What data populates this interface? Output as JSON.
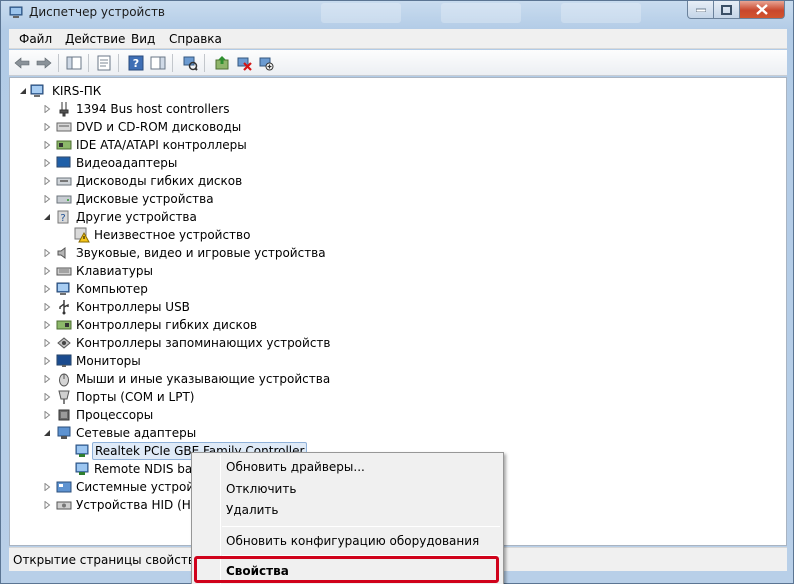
{
  "window": {
    "title": "Диспетчер устройств"
  },
  "menu": [
    "Файл",
    "Действие",
    "Вид",
    "Справка"
  ],
  "tree": {
    "root": "KIRS-ПК",
    "items": [
      {
        "label": "1394 Bus host controllers",
        "icon": "firewire-icon",
        "level": 1,
        "expanded": false
      },
      {
        "label": "DVD и CD-ROM дисководы",
        "icon": "dvd-drive-icon",
        "level": 1,
        "expanded": false
      },
      {
        "label": "IDE ATA/ATAPI контроллеры",
        "icon": "ide-controller-icon",
        "level": 1,
        "expanded": false
      },
      {
        "label": "Видеоадаптеры",
        "icon": "display-adapter-icon",
        "level": 1,
        "expanded": false
      },
      {
        "label": "Дисководы гибких дисков",
        "icon": "floppy-drive-icon",
        "level": 1,
        "expanded": false
      },
      {
        "label": "Дисковые устройства",
        "icon": "disk-drive-icon",
        "level": 1,
        "expanded": false
      },
      {
        "label": "Другие устройства",
        "icon": "other-devices-icon",
        "level": 1,
        "expanded": true
      },
      {
        "label": "Неизвестное устройство",
        "icon": "unknown-device-warning-icon",
        "level": 2,
        "expanded": null
      },
      {
        "label": "Звуковые, видео и игровые устройства",
        "icon": "speaker-icon",
        "level": 1,
        "expanded": false
      },
      {
        "label": "Клавиатуры",
        "icon": "keyboard-icon",
        "level": 1,
        "expanded": false
      },
      {
        "label": "Компьютер",
        "icon": "computer-icon",
        "level": 1,
        "expanded": false
      },
      {
        "label": "Контроллеры USB",
        "icon": "usb-icon",
        "level": 1,
        "expanded": false
      },
      {
        "label": "Контроллеры гибких дисков",
        "icon": "floppy-controller-icon",
        "level": 1,
        "expanded": false
      },
      {
        "label": "Контроллеры запоминающих устройств",
        "icon": "storage-controller-icon",
        "level": 1,
        "expanded": false
      },
      {
        "label": "Мониторы",
        "icon": "monitor-icon",
        "level": 1,
        "expanded": false
      },
      {
        "label": "Мыши и иные указывающие устройства",
        "icon": "mouse-icon",
        "level": 1,
        "expanded": false
      },
      {
        "label": "Порты (COM и LPT)",
        "icon": "port-icon",
        "level": 1,
        "expanded": false
      },
      {
        "label": "Процессоры",
        "icon": "processor-icon",
        "level": 1,
        "expanded": false
      },
      {
        "label": "Сетевые адаптеры",
        "icon": "network-adapter-icon",
        "level": 1,
        "expanded": true
      },
      {
        "label": "Realtek PCIe GBE Family Controller",
        "icon": "network-card-icon",
        "level": 2,
        "expanded": null,
        "selected": true
      },
      {
        "label": "Remote NDIS based",
        "icon": "network-card-icon",
        "level": 2,
        "expanded": null
      },
      {
        "label": "Системные устройс",
        "icon": "system-devices-icon",
        "level": 1,
        "expanded": false
      },
      {
        "label": "Устройства HID (Hum",
        "icon": "hid-icon",
        "level": 1,
        "expanded": false
      }
    ]
  },
  "status": "Открытие страницы свойств для",
  "context_menu": {
    "update_drivers": "Обновить драйверы...",
    "disable": "Отключить",
    "delete": "Удалить",
    "scan_hardware": "Обновить конфигурацию оборудования",
    "properties": "Свойства"
  },
  "colors": {
    "highlight": "#d0021b",
    "selection": "#dfeaf7"
  }
}
